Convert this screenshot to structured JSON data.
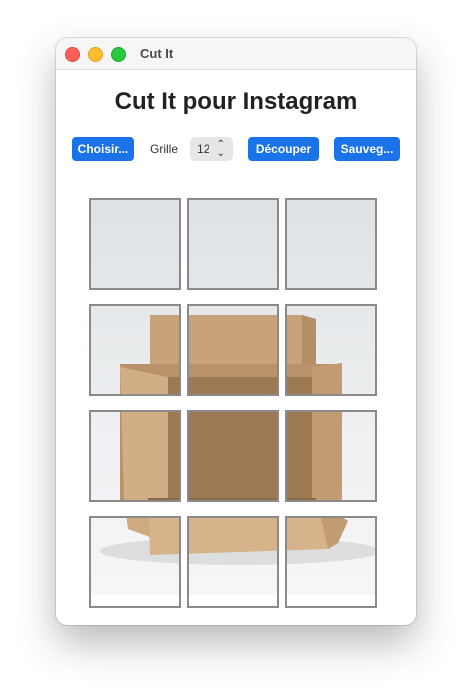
{
  "window": {
    "title": "Cut It"
  },
  "main": {
    "heading": "Cut It pour Instagram"
  },
  "toolbar": {
    "choose_label": "Choisir...",
    "grid_label": "Grille",
    "grid_value": "12",
    "cut_label": "Découper",
    "save_label": "Sauveg..."
  },
  "grid": {
    "rows": 4,
    "columns": 3,
    "tile_count": 12
  },
  "colors": {
    "accent": "#1a73e8",
    "close": "#fe5f57",
    "minimize": "#febc2e",
    "maximize": "#28c840"
  },
  "icons": {
    "select_arrows": "chevron-up-down-icon"
  }
}
